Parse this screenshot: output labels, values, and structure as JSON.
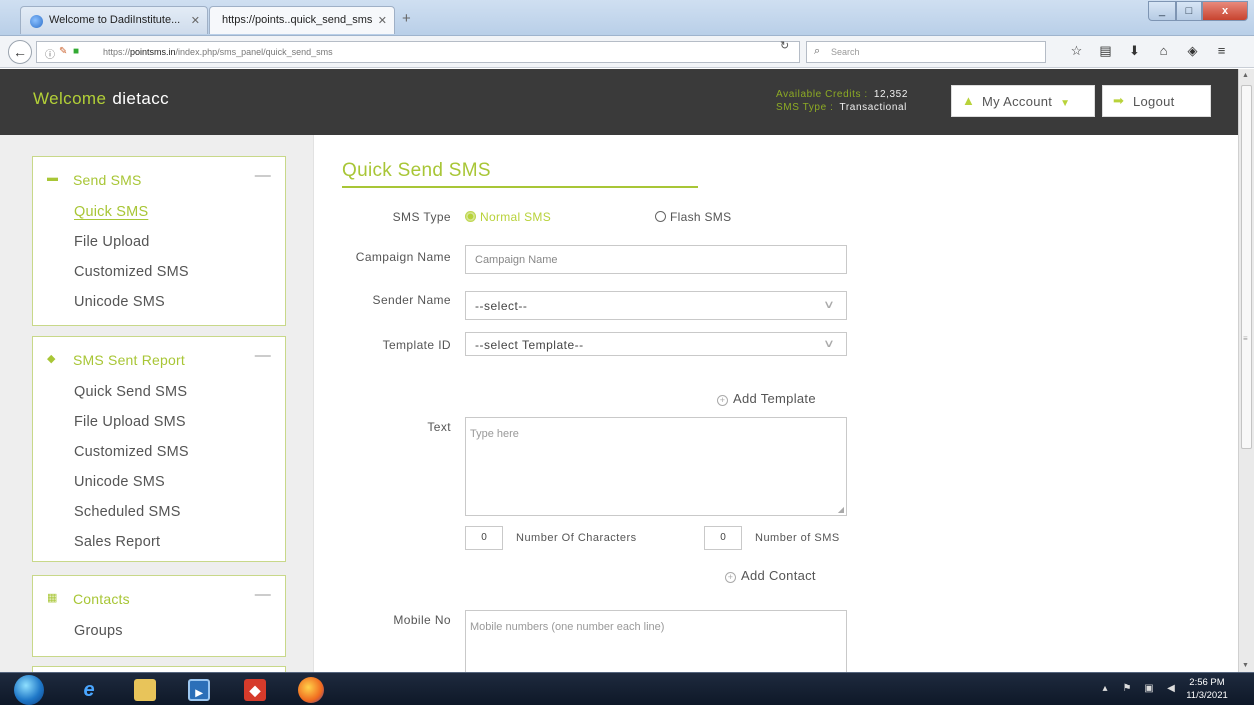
{
  "browser": {
    "tabs": [
      {
        "title": "Welcome to DadiInstitute..."
      },
      {
        "title": "https://points..quick_send_sms"
      }
    ],
    "new_tab": "+",
    "url_prefix": "https://",
    "url_host": "pointsms.in",
    "url_path": "/index.php/sms_panel/quick_send_sms",
    "search_placeholder": "Search",
    "window_buttons": [
      "_",
      "□",
      "x"
    ]
  },
  "header": {
    "welcome_label": "Welcome",
    "username": "dietacc",
    "credits_label": "Available Credits :",
    "credits_value": "12,352",
    "sms_type_label": "SMS Type :",
    "sms_type_value": "Transactional",
    "my_account_label": "My Account",
    "logout_label": "Logout"
  },
  "sidebar": {
    "send_sms": {
      "title": "Send SMS",
      "items": [
        "Quick SMS",
        "File Upload",
        "Customized SMS",
        "Unicode SMS"
      ]
    },
    "sent_report": {
      "title": "SMS Sent Report",
      "items": [
        "Quick Send SMS",
        "File Upload SMS",
        "Customized SMS",
        "Unicode SMS",
        "Scheduled SMS",
        "Sales Report"
      ]
    },
    "contacts": {
      "title": "Contacts",
      "items": [
        "Groups"
      ]
    },
    "collapse_symbol": "—"
  },
  "form": {
    "title": "Quick Send SMS",
    "sms_type_label": "SMS Type",
    "normal_sms": "Normal SMS",
    "flash_sms": "Flash SMS",
    "campaign_label": "Campaign Name",
    "campaign_placeholder": "Campaign Name",
    "sender_label": "Sender Name",
    "sender_value": "--select--",
    "template_label": "Template ID",
    "template_value": "--select Template--",
    "add_template": "Add Template",
    "text_label": "Text",
    "text_placeholder": "Type here",
    "char_count": "0",
    "char_label": "Number Of Characters",
    "sms_count": "0",
    "sms_label": "Number of SMS",
    "add_contact": "Add Contact",
    "mobile_label": "Mobile No",
    "mobile_placeholder": "Mobile numbers (one number each line)"
  },
  "taskbar": {
    "time": "2:56 PM",
    "date": "11/3/2021"
  },
  "colors": {
    "accent": "#a8c636",
    "header_bg": "#3a3a3a",
    "sidebar_bg": "#eeeeee"
  }
}
